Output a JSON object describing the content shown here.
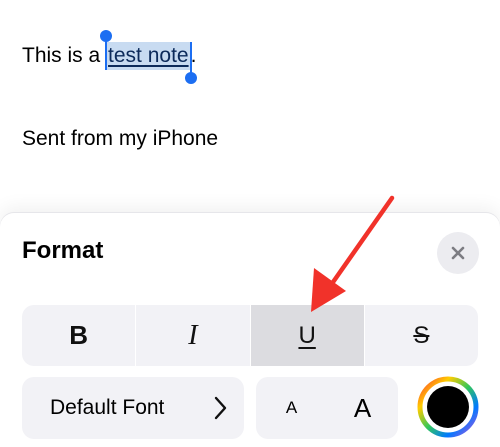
{
  "note": {
    "line1_prefix": "This is a ",
    "line1_selected": "test note",
    "line1_suffix": ".",
    "line2": "Sent from my iPhone"
  },
  "format_panel": {
    "title": "Format",
    "close_icon": "close-x-icon",
    "styles": [
      {
        "label": "B",
        "name": "bold"
      },
      {
        "label": "I",
        "name": "italic"
      },
      {
        "label": "U",
        "name": "underline",
        "active": true
      },
      {
        "label": "S",
        "name": "strikethrough"
      }
    ],
    "font_button": {
      "label": "Default Font",
      "icon": "chevron-right-icon"
    },
    "size_buttons": {
      "smaller": "A",
      "larger": "A"
    },
    "color_button": {
      "icon": "color-wheel-icon",
      "current_color": "#000000"
    }
  },
  "colors": {
    "selection": "#c8dbf1",
    "handle": "#1c6ef2",
    "annotation_arrow": "#f1322a"
  }
}
